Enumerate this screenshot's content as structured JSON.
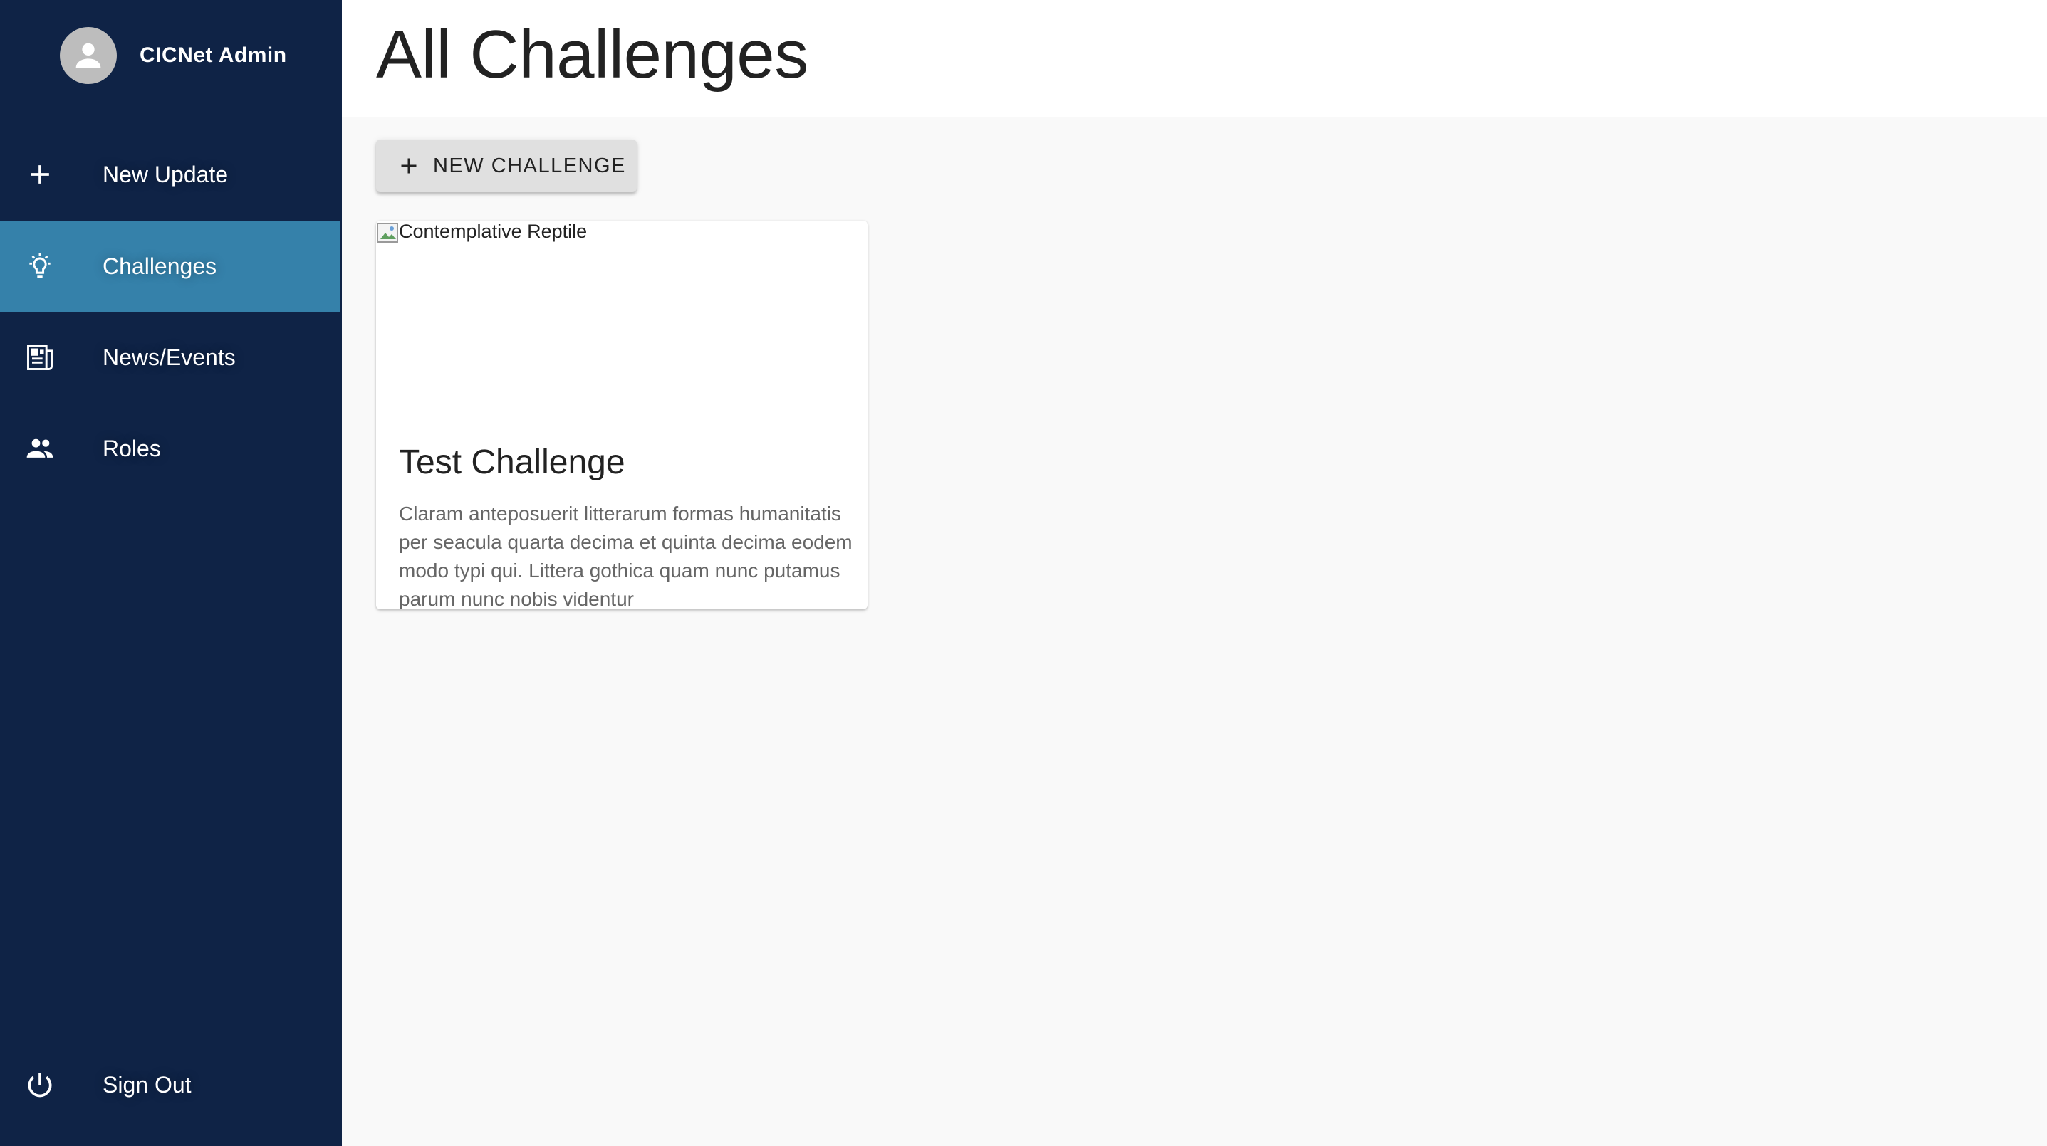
{
  "sidebar": {
    "profile": {
      "name": "CICNet Admin",
      "avatar_icon": "account-circle-icon"
    },
    "items": [
      {
        "label": "New Update",
        "icon": "plus-icon",
        "active": false
      },
      {
        "label": "Challenges",
        "icon": "lightbulb-icon",
        "active": true
      },
      {
        "label": "News/Events",
        "icon": "newspaper-icon",
        "active": false
      },
      {
        "label": "Roles",
        "icon": "people-icon",
        "active": false
      }
    ],
    "sign_out": {
      "label": "Sign Out",
      "icon": "power-icon"
    }
  },
  "header": {
    "title": "All Challenges"
  },
  "main": {
    "new_button": {
      "label": "NEW CHALLENGE",
      "icon": "plus-icon"
    },
    "cards": [
      {
        "image_alt": "Contemplative Reptile",
        "title": "Test Challenge",
        "description": "Claram anteposuerit litterarum formas humanitatis per seacula quarta decima et quinta decima eodem modo typi qui. Littera gothica quam nunc putamus parum nunc nobis videntur"
      }
    ]
  },
  "colors": {
    "sidebar_bg": "#0f2346",
    "active_item_bg": "#3581aa",
    "page_bg": "#f9f9f9",
    "header_bg": "#ffffff",
    "button_bg": "#e0e0e0"
  }
}
